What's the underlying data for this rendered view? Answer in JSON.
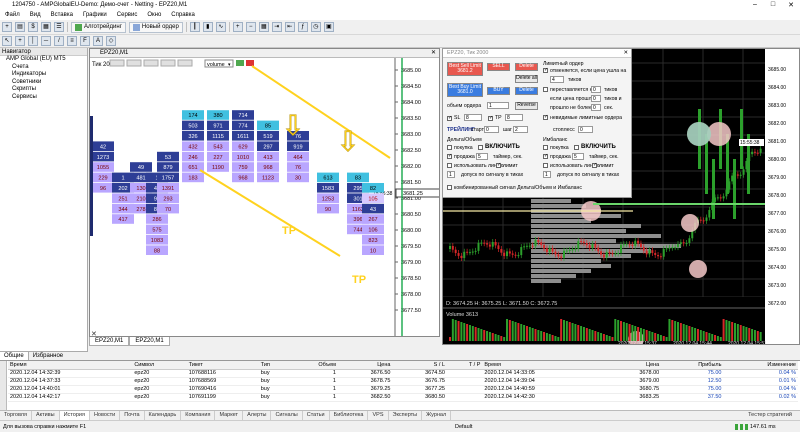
{
  "window": {
    "title": "1204750 - AMPGlobalEU-Demo: Демо-счет - Netting - EPZ20,M1"
  },
  "menu": [
    "Файл",
    "Вид",
    "Вставка",
    "Графики",
    "Сервис",
    "Окно",
    "Справка"
  ],
  "toolbar": {
    "algo_trading": "Алготрейдинг",
    "new_order": "Новый ордер"
  },
  "navigator": {
    "title": "Навигатор",
    "items": [
      "AMP Global (EU) MT5",
      "Счета",
      "Индикаторы",
      "Советники",
      "Скрипты",
      "Сервисы"
    ],
    "tabs": [
      "Общие",
      "Избранное"
    ]
  },
  "chart1": {
    "title": "EPZ20,M1",
    "period_label": "Тик 2000",
    "volume_select": "volume",
    "price_axis": [
      "3685.00",
      "3684.50",
      "3684.00",
      "3683.50",
      "3683.00",
      "3682.50",
      "3682.00",
      "3681.50",
      "3681.00",
      "3680.50",
      "3680.00",
      "3679.50",
      "3679.00",
      "3678.50",
      "3678.00",
      "3677.50"
    ],
    "current_price": "3681.25",
    "current_time": "15:55:38",
    "tp_labels": [
      "TP",
      "TP"
    ],
    "arrow_symbol": "⇩",
    "colors": {
      "accent": "#ffd21f",
      "bid_cells": "#b9a6ff",
      "ask_cells": "#2e3e96",
      "highlight": "#40c0e0",
      "bars": "#1e2a6e"
    },
    "columns": [
      {
        "cells": [
          "42",
          "1273",
          "1055",
          "229",
          "96"
        ],
        "top_row": 6
      },
      {
        "cells": [
          "1",
          "202",
          "251",
          "344",
          "417"
        ],
        "top_row": 9
      },
      {
        "cells": [
          "49",
          "481",
          "130",
          "210",
          "278"
        ],
        "top_row": 8
      },
      {
        "cells": [
          "1",
          "47",
          "94",
          "88",
          "286",
          "575",
          "1083",
          "88"
        ],
        "top_row": 9
      },
      {
        "cells": [
          "53",
          "879",
          "1757",
          "1391",
          "293",
          "70"
        ],
        "top_row": 7
      },
      {
        "cells": [
          "174",
          "503",
          "326",
          "432",
          "246",
          "651",
          "183"
        ],
        "top_row": 3
      },
      {
        "cells": [
          "380",
          "971",
          "1115",
          "543",
          "227",
          "1190"
        ],
        "top_row": 3
      },
      {
        "cells": [
          "714",
          "774",
          "1611",
          "629",
          "1010",
          "759",
          "968"
        ],
        "top_row": 3
      },
      {
        "cells": [
          "85",
          "519",
          "297",
          "413",
          "968",
          "1123"
        ],
        "top_row": 4
      },
      {
        "cells": [
          "76",
          "919",
          "464",
          "76",
          "30"
        ],
        "top_row": 5
      },
      {
        "cells": [
          "613",
          "1583",
          "1253",
          "90"
        ],
        "top_row": 9
      },
      {
        "cells": [
          "83",
          "295",
          "301",
          "1162",
          "396",
          "744"
        ],
        "top_row": 9
      },
      {
        "cells": [
          "82",
          "105",
          "43",
          "267",
          "106",
          "823",
          "10"
        ],
        "top_row": 10
      }
    ]
  },
  "chart1_tabs": [
    "EPZ20,M1",
    "EPZ20,M1"
  ],
  "order_panel": {
    "title": "EPZ20, Тик 2000",
    "best_sell": "Best Sell Limit 3681.2",
    "sell": "SELL",
    "delete1": "Delete",
    "best_buy": "Best Buy Limit 3681.0",
    "buy": "BUY",
    "delete_all": "Delete all",
    "delete2": "Delete",
    "volume_label": "объем ордера",
    "volume_value": "1",
    "reverse": "Reverse",
    "sl_label": "SL",
    "sl_value": "8",
    "tp_label": "TP",
    "tp_value": "8",
    "trailing": "ТРЕЙЛИНГ",
    "trailing_start": "старт",
    "trailing_start_value": "0",
    "step_label": "шаг",
    "step_value": "2",
    "stopless": "стоплесс",
    "stopless_value": "0",
    "pending_title": "Лимитный ордер",
    "pending_1": "отменяется, если цена ушла на",
    "pending_1_value": "4",
    "ticks": "тиков",
    "pending_2": "переставляется на",
    "pending_2_value": "0",
    "ticks2": "тиков",
    "pending_3": "если цена прошла",
    "pending_3_value": "0",
    "ticks3": "тиков и",
    "pending_4": "прошло не более",
    "pending_4_value": "0",
    "sec": "сек.",
    "invisible": "невидимые лимитные ордера",
    "delta_title": "Дельта/Объем",
    "enable1": "ВКЛЮЧИТЬ",
    "buy_lbl": "покупка",
    "sell_lbl": "продажа",
    "timer_lbl": "таймер, сек.",
    "timer_value1": "5",
    "use_line": "использовать линию",
    "limit_lbl": "лимит",
    "allow_trades": "допуск по сигналу в тиках",
    "allow_value": "1",
    "imbalance_title": "Имбаланс",
    "enable2": "ВКЛЮЧИТЬ",
    "timer_value2": "5",
    "combined": "комбинированный сигнал Дельта/Объем и Имбаланс"
  },
  "chart2": {
    "price_axis": [
      "3685.00",
      "3684.00",
      "3683.00",
      "3682.00",
      "3681.00",
      "3680.00",
      "3679.00",
      "3678.00",
      "3677.00",
      "3676.00",
      "3675.00",
      "3674.00",
      "3673.00",
      "3672.00"
    ],
    "current_time": "15:55:38",
    "ohlc": "D: 3674.25  H: 3675.25  L: 3671.50  C: 3672.75",
    "volume_label": "Volume 3613",
    "dates": [
      "2020.12.04 15:37",
      "2020.12.04 15:44",
      "2020.12.04 15:51"
    ],
    "colors": {
      "up": "#2ca02c",
      "down": "#d62728",
      "highlight_circle": "#f5c8c8"
    }
  },
  "terminal": {
    "columns": [
      "Время",
      "Символ",
      "Тикет",
      "Тип",
      "Объем",
      "Цена",
      "S / L",
      "T / P",
      "Время",
      "Цена",
      "Прибыль",
      "Изменение"
    ],
    "rows": [
      [
        "2020.12.04 14:32:39",
        "epz20",
        "107688116",
        "buy",
        "1",
        "3676.50",
        "3674.50",
        "",
        "2020.12.04 14:33:05",
        "3678.00",
        "75.00",
        "0.04 %"
      ],
      [
        "2020.12.04 14:37:33",
        "epz20",
        "107688569",
        "buy",
        "1",
        "3678.75",
        "3676.75",
        "",
        "2020.12.04 14:39:04",
        "3679.00",
        "12.50",
        "0.01 %"
      ],
      [
        "2020.12.04 14:40:01",
        "epz20",
        "107690416",
        "buy",
        "1",
        "3679.25",
        "3677.25",
        "",
        "2020.12.04 14:40:59",
        "3680.75",
        "75.00",
        "0.04 %"
      ],
      [
        "2020.12.04 14:42:17",
        "epz20",
        "107691199",
        "buy",
        "1",
        "3682.50",
        "3680.50",
        "",
        "2020.12.04 14:42:30",
        "3683.25",
        "37.50",
        "0.02 %"
      ]
    ]
  },
  "bottom_tabs": [
    "Торговля",
    "Активы",
    "История",
    "Новости",
    "Почта",
    "Календарь",
    "Компания",
    "Маркет",
    "Алерты",
    "Сигналы",
    "Статьи",
    "Библиотека",
    "VPS",
    "Эксперты",
    "Журнал"
  ],
  "bottom_tabs_active": "История",
  "tester": "Тестер стратегий",
  "status": {
    "help": "Для вызова справки нажмите F1",
    "profile": "Default",
    "traffic": "147.61 ms"
  }
}
